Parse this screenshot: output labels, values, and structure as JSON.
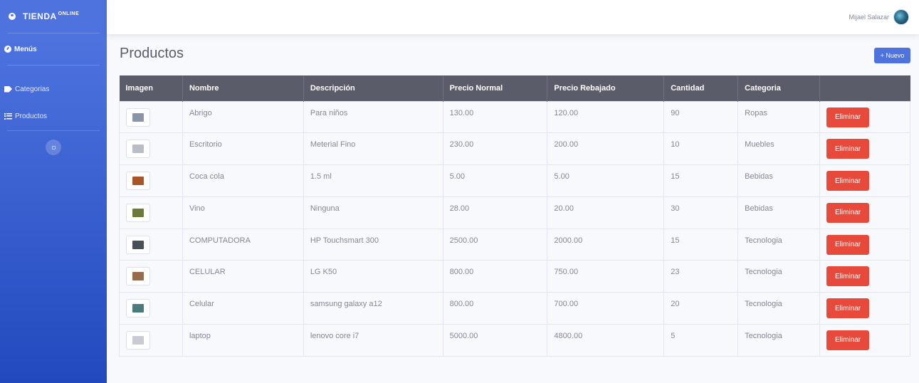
{
  "brand": {
    "name": "TIENDA",
    "suffix": "ONLINE"
  },
  "sidebar": {
    "heading": "Menús",
    "items": [
      {
        "label": "Categorias",
        "icon": "tags-icon"
      },
      {
        "label": "Productos",
        "icon": "list-icon"
      }
    ]
  },
  "topbar": {
    "user_name": "Mijael Salazar"
  },
  "page": {
    "title": "Productos",
    "new_button": "+ Nuevo"
  },
  "table": {
    "columns": [
      "Imagen",
      "Nombre",
      "Descripción",
      "Precio Normal",
      "Precio Rebajado",
      "Cantidad",
      "Categoria",
      ""
    ],
    "delete_label": "Eliminar",
    "rows": [
      {
        "name": "Abrigo",
        "description": "Para niños",
        "price": "130.00",
        "sale_price": "120.00",
        "quantity": "90",
        "category": "Ropas",
        "thumb_color": "#8a96a8"
      },
      {
        "name": "Escritorio",
        "description": "Meterial Fino",
        "price": "230.00",
        "sale_price": "200.00",
        "quantity": "10",
        "category": "Muebles",
        "thumb_color": "#b9bec6"
      },
      {
        "name": "Coca cola",
        "description": "1.5 ml",
        "price": "5.00",
        "sale_price": "5.00",
        "quantity": "15",
        "category": "Bebidas",
        "thumb_color": "#a8552a"
      },
      {
        "name": "Vino",
        "description": "Ninguna",
        "price": "28.00",
        "sale_price": "20.00",
        "quantity": "30",
        "category": "Bebidas",
        "thumb_color": "#6b7a3a"
      },
      {
        "name": "COMPUTADORA",
        "description": "HP Touchsmart 300",
        "price": "2500.00",
        "sale_price": "2000.00",
        "quantity": "15",
        "category": "Tecnologia",
        "thumb_color": "#4a5058"
      },
      {
        "name": "CELULAR",
        "description": "LG K50",
        "price": "800.00",
        "sale_price": "750.00",
        "quantity": "23",
        "category": "Tecnologia",
        "thumb_color": "#9a6a4a"
      },
      {
        "name": "Celular",
        "description": "samsung galaxy a12",
        "price": "800.00",
        "sale_price": "700.00",
        "quantity": "20",
        "category": "Tecnologia",
        "thumb_color": "#4a7a7a"
      },
      {
        "name": "laptop",
        "description": "lenovo core i7",
        "price": "5000.00",
        "sale_price": "4800.00",
        "quantity": "5",
        "category": "Tecnologia",
        "thumb_color": "#c8ccd2"
      }
    ]
  }
}
